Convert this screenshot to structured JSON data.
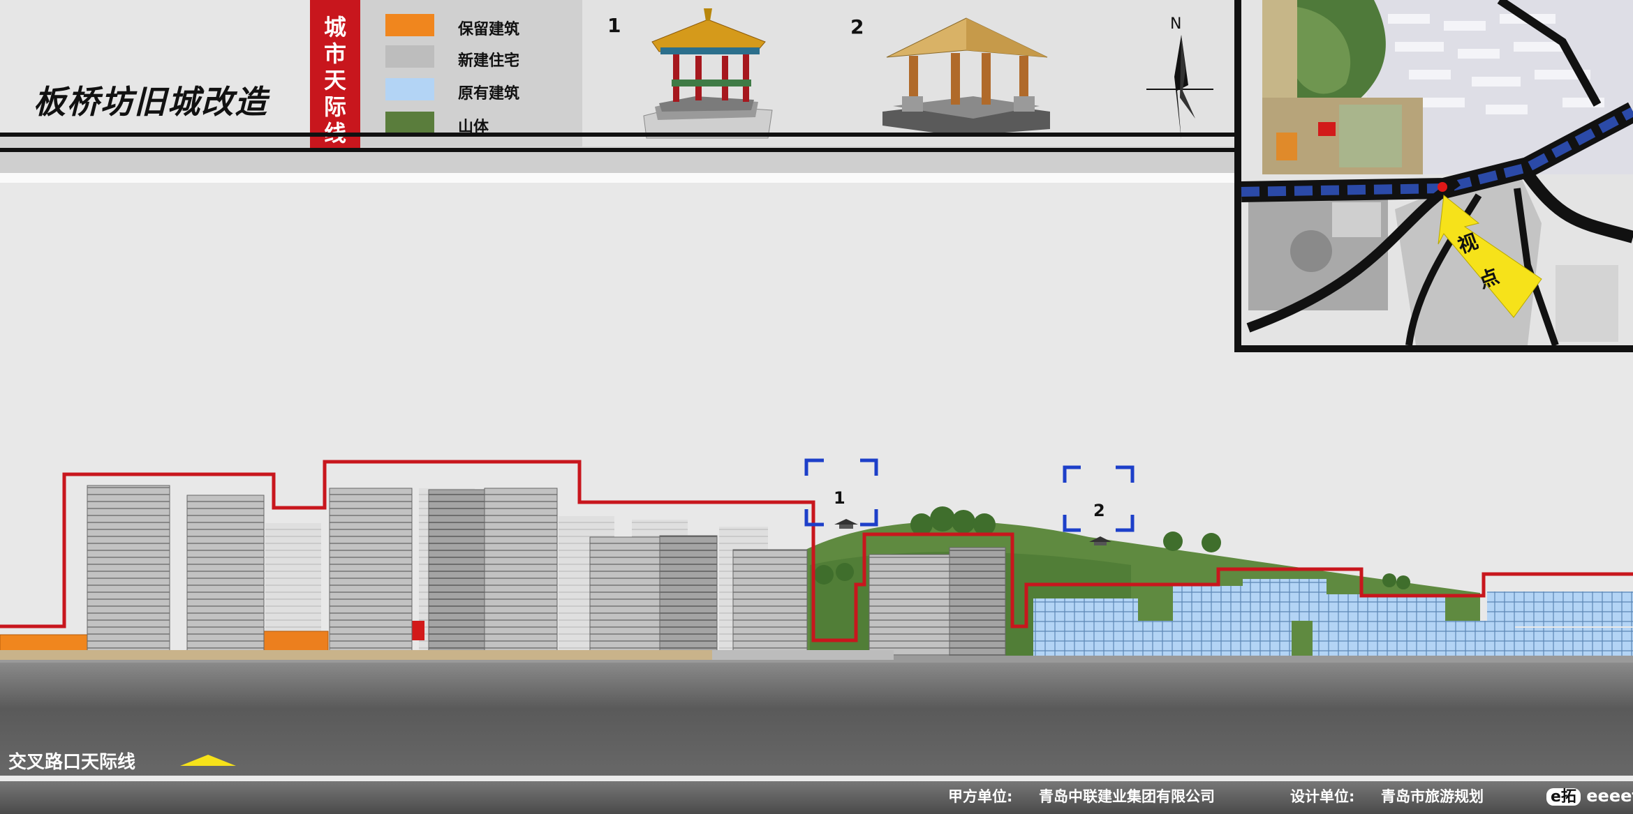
{
  "header": {
    "title": "板桥坊旧城改造",
    "tag_chars": [
      "城",
      "市",
      "天",
      "际",
      "线"
    ]
  },
  "legend": [
    {
      "label": "保留建筑",
      "color": "#f0861e"
    },
    {
      "label": "新建住宅",
      "color": "#bdbdbd"
    },
    {
      "label": "原有建筑",
      "color": "#b3d4f5"
    },
    {
      "label": "山体",
      "color": "#5a7d3c"
    }
  ],
  "pavilions": [
    {
      "number": "1"
    },
    {
      "number": "2"
    }
  ],
  "compass": {
    "label": "N"
  },
  "keymap": {
    "viewpoint_chars": [
      "视",
      "点"
    ]
  },
  "section": {
    "callouts": [
      "1",
      "2"
    ],
    "intersection_label": "交叉路口天际线"
  },
  "footer": {
    "client_label": "甲方单位:",
    "client": "青岛中联建业集团有限公司",
    "designer_label": "设计单位:",
    "designer": "青岛市旅游规划",
    "site_logo": "e拓",
    "site_url": "eeeetop.com"
  },
  "colors": {
    "skyline_line": "#c8161d",
    "callout": "#1d3fc9",
    "tag_red": "#c8161d",
    "viewpoint_arrow": "#f6e21a"
  }
}
